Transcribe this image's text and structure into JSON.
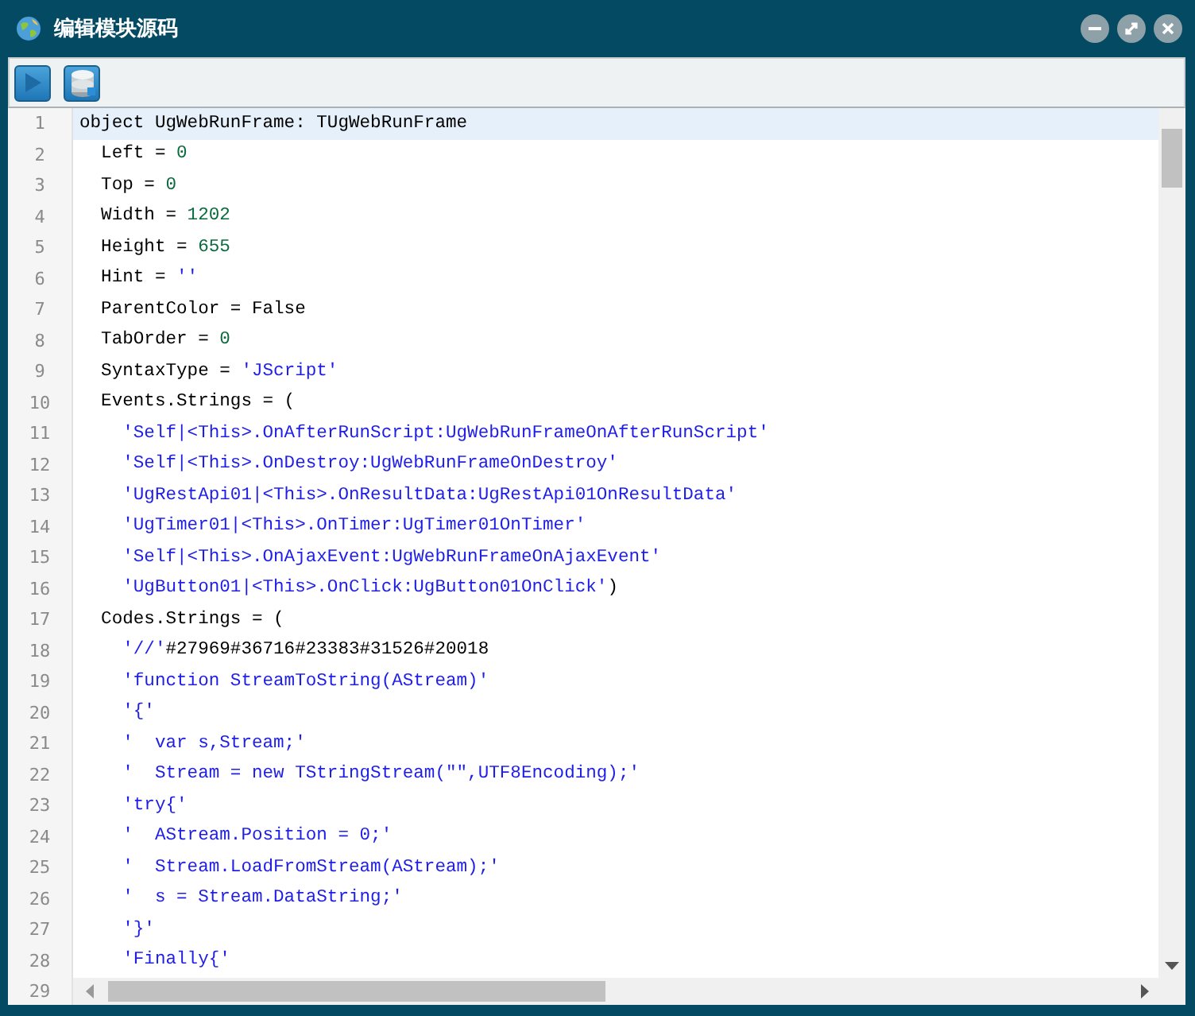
{
  "window": {
    "title": "编辑模块源码"
  },
  "toolbar": {
    "buttons": [
      {
        "kind": "run"
      },
      {
        "kind": "database"
      }
    ]
  },
  "editor": {
    "lines": [
      {
        "number": "1",
        "current": true,
        "segments": [
          {
            "kind": "plain",
            "text": "object UgWebRunFrame: TUgWebRunFrame"
          }
        ]
      },
      {
        "number": "2",
        "current": false,
        "segments": [
          {
            "kind": "plain",
            "text": "  Left = "
          },
          {
            "kind": "number",
            "text": "0"
          }
        ]
      },
      {
        "number": "3",
        "current": false,
        "segments": [
          {
            "kind": "plain",
            "text": "  Top = "
          },
          {
            "kind": "number",
            "text": "0"
          }
        ]
      },
      {
        "number": "4",
        "current": false,
        "segments": [
          {
            "kind": "plain",
            "text": "  Width = "
          },
          {
            "kind": "number",
            "text": "1202"
          }
        ]
      },
      {
        "number": "5",
        "current": false,
        "segments": [
          {
            "kind": "plain",
            "text": "  Height = "
          },
          {
            "kind": "number",
            "text": "655"
          }
        ]
      },
      {
        "number": "6",
        "current": false,
        "segments": [
          {
            "kind": "plain",
            "text": "  Hint = "
          },
          {
            "kind": "string",
            "text": "''"
          }
        ]
      },
      {
        "number": "7",
        "current": false,
        "segments": [
          {
            "kind": "plain",
            "text": "  ParentColor = False"
          }
        ]
      },
      {
        "number": "8",
        "current": false,
        "segments": [
          {
            "kind": "plain",
            "text": "  TabOrder = "
          },
          {
            "kind": "number",
            "text": "0"
          }
        ]
      },
      {
        "number": "9",
        "current": false,
        "segments": [
          {
            "kind": "plain",
            "text": "  SyntaxType = "
          },
          {
            "kind": "string",
            "text": "'JScript'"
          }
        ]
      },
      {
        "number": "10",
        "current": false,
        "segments": [
          {
            "kind": "plain",
            "text": "  Events.Strings = ("
          }
        ]
      },
      {
        "number": "11",
        "current": false,
        "segments": [
          {
            "kind": "string",
            "text": "    'Self|<This>.OnAfterRunScript:UgWebRunFrameOnAfterRunScript'"
          }
        ]
      },
      {
        "number": "12",
        "current": false,
        "segments": [
          {
            "kind": "string",
            "text": "    'Self|<This>.OnDestroy:UgWebRunFrameOnDestroy'"
          }
        ]
      },
      {
        "number": "13",
        "current": false,
        "segments": [
          {
            "kind": "string",
            "text": "    'UgRestApi01|<This>.OnResultData:UgRestApi01OnResultData'"
          }
        ]
      },
      {
        "number": "14",
        "current": false,
        "segments": [
          {
            "kind": "string",
            "text": "    'UgTimer01|<This>.OnTimer:UgTimer01OnTimer'"
          }
        ]
      },
      {
        "number": "15",
        "current": false,
        "segments": [
          {
            "kind": "string",
            "text": "    'Self|<This>.OnAjaxEvent:UgWebRunFrameOnAjaxEvent'"
          }
        ]
      },
      {
        "number": "16",
        "current": false,
        "segments": [
          {
            "kind": "string",
            "text": "    'UgButton01|<This>.OnClick:UgButton01OnClick'"
          },
          {
            "kind": "plain",
            "text": ")"
          }
        ]
      },
      {
        "number": "17",
        "current": false,
        "segments": [
          {
            "kind": "plain",
            "text": "  Codes.Strings = ("
          }
        ]
      },
      {
        "number": "18",
        "current": false,
        "segments": [
          {
            "kind": "string",
            "text": "    '//'"
          },
          {
            "kind": "plain",
            "text": "#27969#36716#23383#31526#20018"
          }
        ]
      },
      {
        "number": "19",
        "current": false,
        "segments": [
          {
            "kind": "string",
            "text": "    'function StreamToString(AStream)'"
          }
        ]
      },
      {
        "number": "20",
        "current": false,
        "segments": [
          {
            "kind": "string",
            "text": "    '{'"
          }
        ]
      },
      {
        "number": "21",
        "current": false,
        "segments": [
          {
            "kind": "string",
            "text": "    '  var s,Stream;'"
          }
        ]
      },
      {
        "number": "22",
        "current": false,
        "segments": [
          {
            "kind": "string",
            "text": "    '  Stream = new TStringStream(\"\",UTF8Encoding);'"
          }
        ]
      },
      {
        "number": "23",
        "current": false,
        "segments": [
          {
            "kind": "string",
            "text": "    'try{'"
          }
        ]
      },
      {
        "number": "24",
        "current": false,
        "segments": [
          {
            "kind": "string",
            "text": "    '  AStream.Position = 0;'"
          }
        ]
      },
      {
        "number": "25",
        "current": false,
        "segments": [
          {
            "kind": "string",
            "text": "    '  Stream.LoadFromStream(AStream);'"
          }
        ]
      },
      {
        "number": "26",
        "current": false,
        "segments": [
          {
            "kind": "string",
            "text": "    '  s = Stream.DataString;'"
          }
        ]
      },
      {
        "number": "27",
        "current": false,
        "segments": [
          {
            "kind": "string",
            "text": "    '}'"
          }
        ]
      },
      {
        "number": "28",
        "current": false,
        "segments": [
          {
            "kind": "string",
            "text": "    'Finally{'"
          }
        ]
      },
      {
        "number": "29",
        "current": false
      }
    ]
  }
}
